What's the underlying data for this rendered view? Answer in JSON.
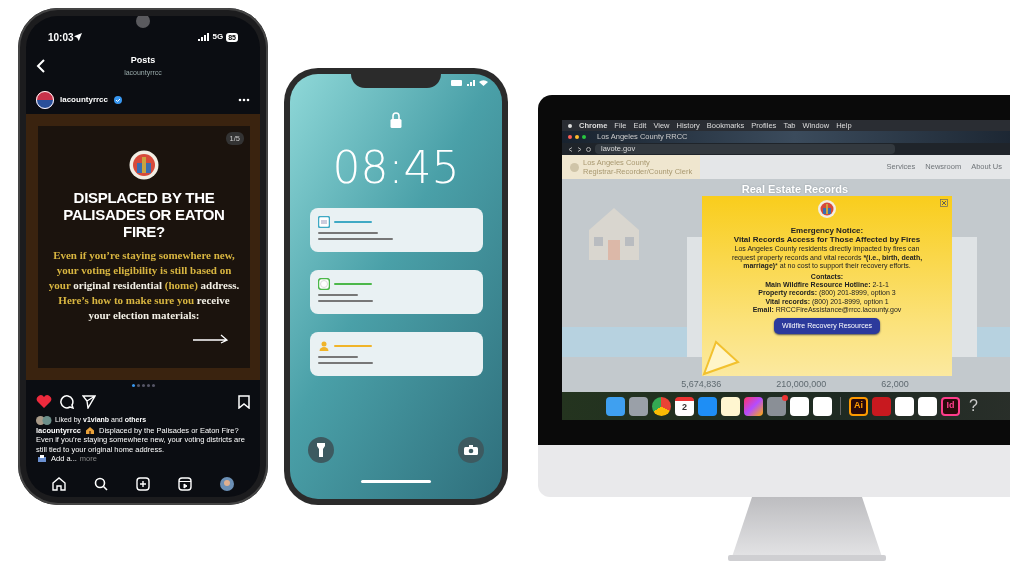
{
  "instagram_phone": {
    "status_bar": {
      "time": "10:03",
      "network": "5G",
      "battery": "85"
    },
    "header": {
      "title": "Posts",
      "subtitle": "lacountyrrcc"
    },
    "post": {
      "username": "lacountyrrcc",
      "verified": true,
      "counter": "1/5",
      "headline": "DISPLACED BY THE PALISADES OR EATON FIRE?",
      "body": [
        {
          "text": "Even if you’re staying somewhere new, your voting eligibility is still based on your ",
          "highlight": true
        },
        {
          "text": "original residential ",
          "highlight": false
        },
        {
          "text": "(home) ",
          "highlight": true
        },
        {
          "text": "address. ",
          "highlight": false
        },
        {
          "text": "Here’s how to make sure you ",
          "highlight": true
        },
        {
          "text": "receive your election materials:",
          "highlight": false
        }
      ],
      "carousel_dots": [
        {
          "selected": true
        },
        {
          "selected": false
        },
        {
          "selected": false
        },
        {
          "selected": false
        },
        {
          "selected": false
        }
      ],
      "liked": true,
      "saved": false,
      "likes_text": "Liked by **v1vianb** and **others**",
      "caption": {
        "username": "lacountyrrcc",
        "text_1": "Displaced by the Palisades or Eaton Fire?",
        "text_2": "Even if you’re staying somewhere new, your voting districts are still tied to your original home address.",
        "text_3": "Add a...",
        "more": "more"
      }
    }
  },
  "lock_phone": {
    "time": "08:45",
    "notifications": [
      {
        "kind": "image",
        "color": "#3fa9c4"
      },
      {
        "kind": "message",
        "color": "#4cb84a"
      },
      {
        "kind": "contact",
        "color": "#f0b429"
      }
    ]
  },
  "monitor": {
    "menu_bar": [
      "Chrome",
      "File",
      "Edit",
      "View",
      "History",
      "Bookmarks",
      "Profiles",
      "Tab",
      "Window",
      "Help"
    ],
    "tab_title": "Los Angeles County RRCC",
    "url": "lavote.gov",
    "site_header": {
      "title": "Los Angeles County",
      "subtitle": "Registrar-Recorder/County Clerk",
      "nav": [
        "Services",
        "Newsroom",
        "About Us"
      ]
    },
    "page_title": "Real Estate Records",
    "popup": {
      "title": "Emergency Notice:",
      "subtitle": "Vital Records Access for Those Affected by Fires",
      "body": "Los Angeles County residents directly impacted by fires can request property records and vital records ***(i.e., birth, death, marriage)*** at no cost to support their recovery efforts.",
      "contacts_heading": "Contacts:",
      "contacts": [
        "**Main Wildfire Resource Hotline:** 2-1-1",
        "**Property records:** (800) 201-8999, option 3",
        "**Vital records:** (800) 201-8999, option 1",
        "**Email:** RRCCFireAssistance@rrcc.lacounty.gov"
      ],
      "button": "Wildfire Recovery Resources"
    },
    "stats": [
      "5,674,836",
      "210,000,000",
      "62,000"
    ],
    "dock": [
      {
        "kind": "finder"
      },
      {
        "kind": "launchpad"
      },
      {
        "kind": "chrome"
      },
      {
        "kind": "calendar",
        "label": "2"
      },
      {
        "kind": "appstore"
      },
      {
        "kind": "notes"
      },
      {
        "kind": "creative"
      },
      {
        "kind": "settings",
        "badge": true
      },
      {
        "kind": "teams"
      },
      {
        "kind": "outlook"
      },
      {
        "kind": "divider"
      },
      {
        "kind": "letter",
        "label": "Ai",
        "color": "#ff9a00"
      },
      {
        "kind": "acrobat"
      },
      {
        "kind": "word"
      },
      {
        "kind": "powerpoint"
      },
      {
        "kind": "letter",
        "label": "Id",
        "color": "#ff3d8b"
      },
      {
        "kind": "help",
        "label": "?"
      }
    ]
  }
}
